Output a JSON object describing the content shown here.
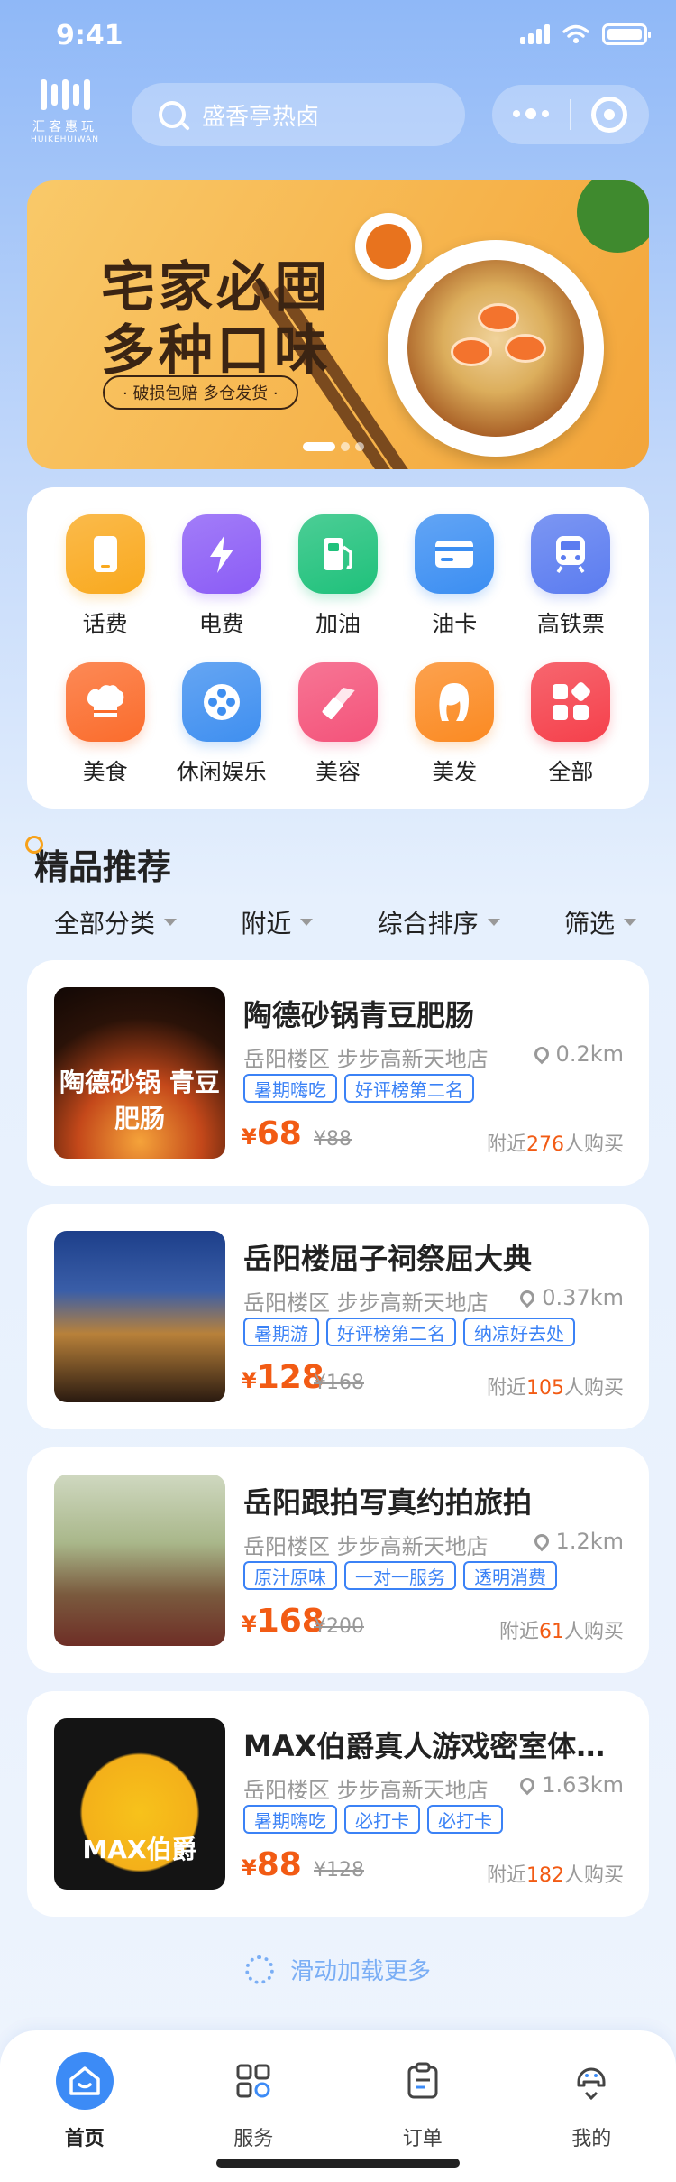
{
  "status_bar": {
    "time": "9:41"
  },
  "header": {
    "logo_cn": "汇客惠玩",
    "logo_en": "HUIKEHUIWAN",
    "search_placeholder": "盛香亭热卤"
  },
  "banner": {
    "title_line1": "宅家必囤",
    "title_line2": "多种口味",
    "tag": "· 破损包赔  多仓发货 ·",
    "active_dot": 0
  },
  "categories": [
    {
      "label": "话费",
      "icon": "phone-icon",
      "color": "#f9a91e"
    },
    {
      "label": "电费",
      "icon": "lightning-icon",
      "color": "#8b5cf6"
    },
    {
      "label": "加油",
      "icon": "fuel-pump-icon",
      "color": "#1fc17b"
    },
    {
      "label": "油卡",
      "icon": "card-icon",
      "color": "#3b8ef2"
    },
    {
      "label": "高铁票",
      "icon": "train-icon",
      "color": "#5b7cf0"
    },
    {
      "label": "美食",
      "icon": "chef-hat-icon",
      "color": "#fb6c2c"
    },
    {
      "label": "休闲娱乐",
      "icon": "film-reel-icon",
      "color": "#3f8ff0"
    },
    {
      "label": "美容",
      "icon": "lipstick-icon",
      "color": "#f4537a"
    },
    {
      "label": "美发",
      "icon": "hair-icon",
      "color": "#fb8a22"
    },
    {
      "label": "全部",
      "icon": "grid-all-icon",
      "color": "#f5404b"
    }
  ],
  "section": {
    "title": "精品推荐",
    "filters": [
      "全部分类",
      "附近",
      "综合排序",
      "筛选"
    ]
  },
  "products": [
    {
      "title": "陶德砂锅青豆肥肠",
      "thumb_text": "陶德砂锅 青豆肥肠",
      "address": "岳阳楼区 步步高新天地店",
      "distance": "0.2km",
      "tags": [
        "暑期嗨吃",
        "好评榜第二名"
      ],
      "price": "68",
      "old_price": "¥88",
      "sold_prefix": "附近",
      "sold_count": "276",
      "sold_suffix": "人购买"
    },
    {
      "title": "岳阳楼屈子祠祭屈大典",
      "thumb_text": "",
      "address": "岳阳楼区 步步高新天地店",
      "distance": "0.37km",
      "tags": [
        "暑期游",
        "好评榜第二名",
        "纳凉好去处"
      ],
      "price": "128",
      "old_price": "¥168",
      "sold_prefix": "附近",
      "sold_count": "105",
      "sold_suffix": "人购买"
    },
    {
      "title": "岳阳跟拍写真约拍旅拍",
      "thumb_text": "",
      "address": "岳阳楼区 步步高新天地店",
      "distance": "1.2km",
      "tags": [
        "原汁原味",
        "一对一服务",
        "透明消费"
      ],
      "price": "168",
      "old_price": "¥200",
      "sold_prefix": "附近",
      "sold_count": "61",
      "sold_suffix": "人购买"
    },
    {
      "title": "MAX伯爵真人游戏密室体验馆",
      "thumb_text": "MAX伯爵",
      "address": "岳阳楼区 步步高新天地店",
      "distance": "1.63km",
      "tags": [
        "暑期嗨吃",
        "必打卡",
        "必打卡"
      ],
      "price": "88",
      "old_price": "¥128",
      "sold_prefix": "附近",
      "sold_count": "182",
      "sold_suffix": "人购买"
    }
  ],
  "loading_text": "滑动加载更多",
  "tabbar": {
    "items": [
      {
        "label": "首页",
        "icon": "home-icon",
        "active": true
      },
      {
        "label": "服务",
        "icon": "services-icon",
        "active": false
      },
      {
        "label": "订单",
        "icon": "orders-icon",
        "active": false
      },
      {
        "label": "我的",
        "icon": "profile-icon",
        "active": false
      }
    ]
  },
  "colors": {
    "accent": "#3c8bf6",
    "price": "#f25b14",
    "tag": "#3b82f6"
  }
}
